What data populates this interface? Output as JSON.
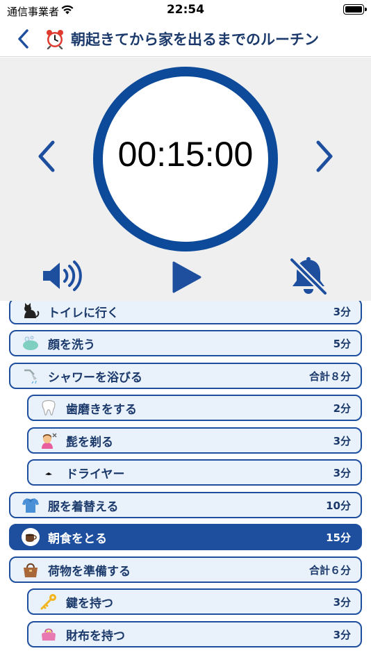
{
  "status_bar": {
    "carrier": "通信事業者",
    "time": "22:54"
  },
  "nav": {
    "title": "朝起きてから家を出るまでのルーチン",
    "title_icon": "alarm-clock-icon"
  },
  "timer": {
    "display": "00:15:00",
    "ring_color": "#0d4a9a"
  },
  "controls": {
    "sound": "speaker-icon",
    "play": "play-icon",
    "notification": "bell-slash-icon"
  },
  "colors": {
    "accent": "#1e4f9e",
    "item_bg": "#e9f1fb",
    "panel_bg": "#efeff0"
  },
  "tasks": [
    {
      "label": "トイレに行く",
      "duration": "3分",
      "icon": "cat-icon",
      "indent": 0
    },
    {
      "label": "顔を洗う",
      "duration": "5分",
      "icon": "soap-icon",
      "indent": 0
    },
    {
      "label": "シャワーを浴びる",
      "duration": "合計８分",
      "icon": "shower-icon",
      "indent": 0
    },
    {
      "label": "歯磨きをする",
      "duration": "2分",
      "icon": "tooth-icon",
      "indent": 1
    },
    {
      "label": "髭を剃る",
      "duration": "3分",
      "icon": "haircut-icon",
      "indent": 1
    },
    {
      "label": "ドライヤー",
      "duration": "3分",
      "icon": "hair-dryer-icon",
      "indent": 1
    },
    {
      "label": "服を着替える",
      "duration": "10分",
      "icon": "shirt-icon",
      "indent": 0
    },
    {
      "label": "朝食をとる",
      "duration": "15分",
      "icon": "coffee-icon",
      "indent": 0,
      "selected": true
    },
    {
      "label": "荷物を準備する",
      "duration": "合計６分",
      "icon": "handbag-icon",
      "indent": 0
    },
    {
      "label": "鍵を持つ",
      "duration": "3分",
      "icon": "key-icon",
      "indent": 1
    },
    {
      "label": "財布を持つ",
      "duration": "3分",
      "icon": "purse-icon",
      "indent": 1
    }
  ]
}
